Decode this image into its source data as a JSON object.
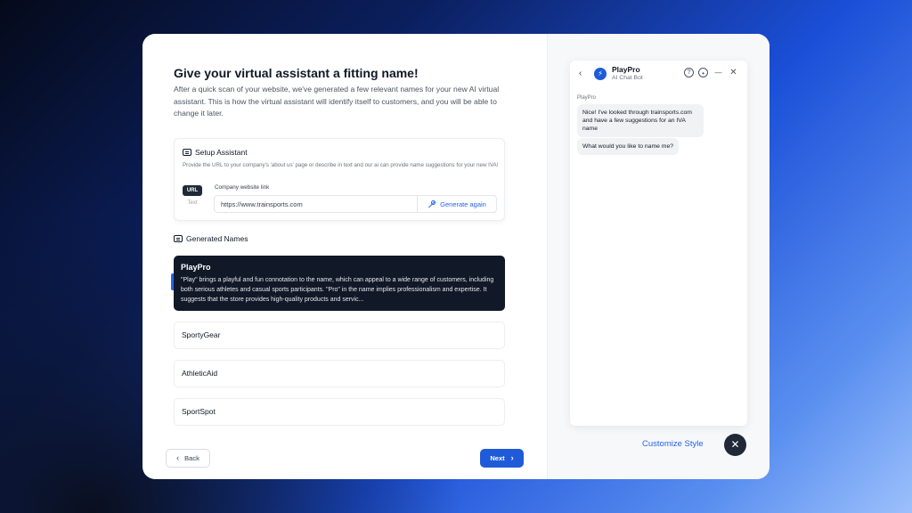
{
  "wizard": {
    "title": "Give your virtual assistant a fitting name!",
    "description": "After a quick scan of your website, we've generated a few relevant names for your new AI virtual assistant. This is how the virtual assistant will identify itself to customers, and you will be able to change it later.",
    "setup": {
      "heading": "Setup Assistant",
      "description": "Provide the URL to your company's 'about us' page or describe in text and our ai can provide name suggestions for your new IVA!",
      "url_tab": "URL",
      "text_tab": "Text",
      "field_label": "Company website link",
      "field_value": "https://www.trainsports.com",
      "generate_label": "Generate again"
    },
    "generated_heading": "Generated Names",
    "names": [
      {
        "name": "PlayPro",
        "description": "\"Play\" brings a playful and fun connotation to the name, which can appeal to a wide range of customers, including both serious athletes and casual sports participants. \"Pro\" in the name implies professionalism and expertise. It suggests that the store provides high-quality products and servic...",
        "selected": true
      },
      {
        "name": "SportyGear"
      },
      {
        "name": "AthleticAid"
      },
      {
        "name": "SportSpot"
      }
    ],
    "back_label": "Back",
    "next_label": "Next"
  },
  "chat": {
    "bot_name": "PlayPro",
    "bot_subtitle": "AI Chat Bot",
    "sender": "PlayPro",
    "messages": [
      "Nice! I've looked through trainsports.com and have a few suggestions for an IVA name",
      "What would you like to name me?"
    ],
    "customize_label": "Customize Style",
    "accent": "#1f5bd8"
  }
}
